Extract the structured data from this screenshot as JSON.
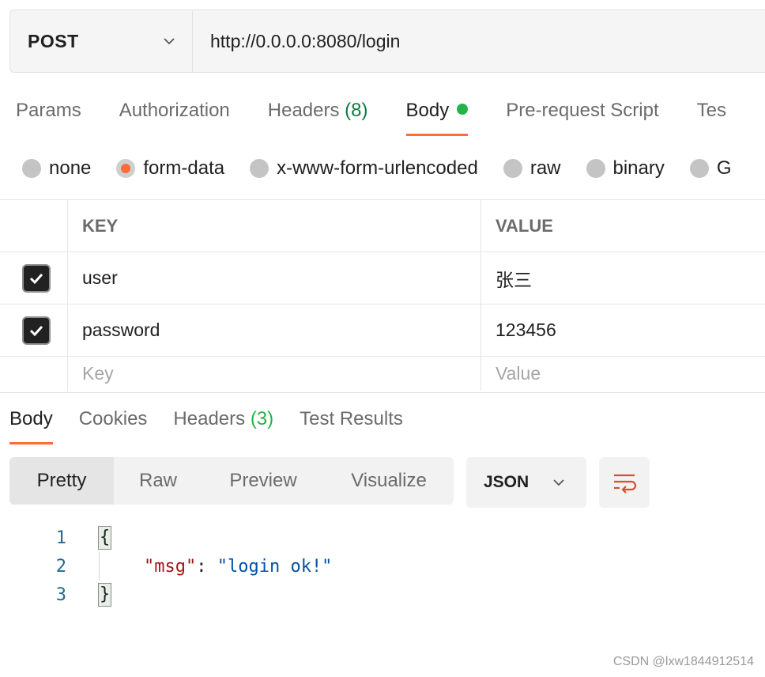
{
  "request": {
    "method": "POST",
    "url": "http://0.0.0.0:8080/login"
  },
  "request_tabs": [
    {
      "label": "Params"
    },
    {
      "label": "Authorization"
    },
    {
      "label": "Headers",
      "count": "(8)"
    },
    {
      "label": "Body",
      "active": true
    },
    {
      "label": "Pre-request Script"
    },
    {
      "label": "Tes"
    }
  ],
  "body_modes": [
    {
      "label": "none"
    },
    {
      "label": "form-data",
      "selected": true
    },
    {
      "label": "x-www-form-urlencoded"
    },
    {
      "label": "raw"
    },
    {
      "label": "binary"
    },
    {
      "label": "G"
    }
  ],
  "form_table": {
    "headers": {
      "key": "KEY",
      "value": "VALUE"
    },
    "rows": [
      {
        "key": "user",
        "value": "张三",
        "checked": true
      },
      {
        "key": "password",
        "value": "123456",
        "checked": true
      }
    ],
    "placeholders": {
      "key": "Key",
      "value": "Value"
    }
  },
  "response_tabs": [
    {
      "label": "Body",
      "active": true
    },
    {
      "label": "Cookies"
    },
    {
      "label": "Headers",
      "count": "(3)"
    },
    {
      "label": "Test Results"
    }
  ],
  "response_views": [
    "Pretty",
    "Raw",
    "Preview",
    "Visualize"
  ],
  "response_format": "JSON",
  "code": {
    "line_numbers": [
      "1",
      "2",
      "3"
    ],
    "open_brace": "{",
    "key": "\"msg\"",
    "colon": ": ",
    "value": "\"login ok!\"",
    "close_brace": "}"
  },
  "watermark": "CSDN @lxw1844912514",
  "colors": {
    "accent": "#ff6c37",
    "body_dot": "#26b247",
    "headers_count": "#0f7b41"
  }
}
